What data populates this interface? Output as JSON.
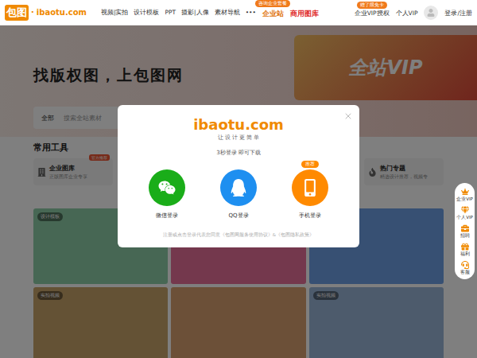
{
  "header": {
    "logo_mark": "包图",
    "logo_dot": "·",
    "logo_text": "ibaotu.com",
    "nav": [
      "视频|实拍",
      "设计模板",
      "PPT",
      "摄影|人像",
      "素材导航",
      "•••"
    ],
    "promos": [
      {
        "label": "企业站",
        "badge": "咨询企业套餐",
        "color": "#e0730b"
      },
      {
        "label": "商用图库",
        "badge": "",
        "color": "#e02b2b"
      }
    ],
    "links": [
      {
        "label": "企业VIP授权",
        "badge": "赠了限免卡"
      },
      {
        "label": "个人VIP",
        "badge": ""
      }
    ],
    "login": "登录/注册"
  },
  "hero": {
    "slogan": "找版权图，上包图网",
    "banner": "全站VIP"
  },
  "search": {
    "category": "全部",
    "placeholder": "搜索全站素材"
  },
  "tools": {
    "title": "常用工具",
    "items": [
      {
        "name": "企业图库",
        "desc": "正版图库企业专享",
        "badge": "官方推荐"
      },
      {
        "name": "热门专题",
        "desc": "精选设计推荐，视频专",
        "badge": ""
      }
    ]
  },
  "gallery": [
    {
      "tag": "设计模板",
      "color": "#8fcfa8"
    },
    {
      "tag": "",
      "color": "#e9709a"
    },
    {
      "tag": "",
      "color": "#6fa0e6"
    },
    {
      "tag": "实拍视频",
      "color": "#c9a46a"
    },
    {
      "tag": "",
      "color": "#d8a070"
    },
    {
      "tag": "实拍视频",
      "color": "#9ab7d8"
    }
  ],
  "sidebar": [
    "企业VIP",
    "个人VIP",
    "招聘",
    "福利",
    "客服"
  ],
  "modal": {
    "logo": "ibaotu.com",
    "slogan": "让 设 计 更 简 单",
    "subtitle": "3秒登录 即可下载",
    "options": [
      {
        "label": "微信登录",
        "kind": "wechat",
        "color": "#1aad19",
        "badge": ""
      },
      {
        "label": "QQ登录",
        "kind": "qq",
        "color": "#1e8ff0",
        "badge": ""
      },
      {
        "label": "手机登录",
        "kind": "phone",
        "color": "#ff8a00",
        "badge": "推荐"
      }
    ],
    "agreement": "注册或点击登录代表您同意《包图网服务使用协议》&《包图隐私政策》"
  }
}
